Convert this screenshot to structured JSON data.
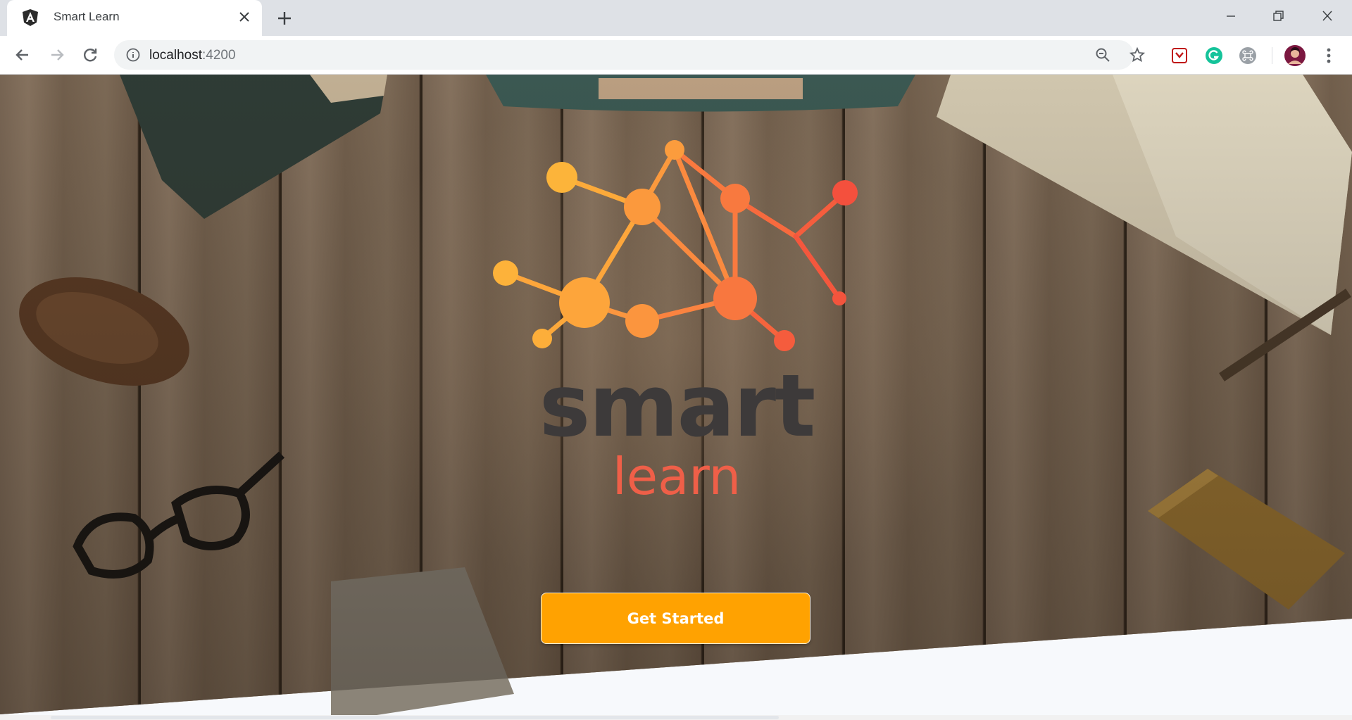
{
  "browser": {
    "tab": {
      "title": "Smart Learn",
      "favicon": "angular-logo-icon"
    },
    "address": {
      "host": "localhost",
      "port": ":4200"
    },
    "icons": {
      "back": "arrow-left-icon",
      "forward": "arrow-right-icon",
      "reload": "reload-icon",
      "zoom": "zoom-out-icon",
      "bookmark": "star-icon",
      "menu": "kebab-menu-icon"
    }
  },
  "hero": {
    "brand_top": "smart",
    "brand_bottom": "learn",
    "cta_label": "Get Started"
  },
  "colors": {
    "brand_orange": "#ffa201",
    "brand_coral": "#ef5f48",
    "brand_dark": "#3d3a3a"
  }
}
